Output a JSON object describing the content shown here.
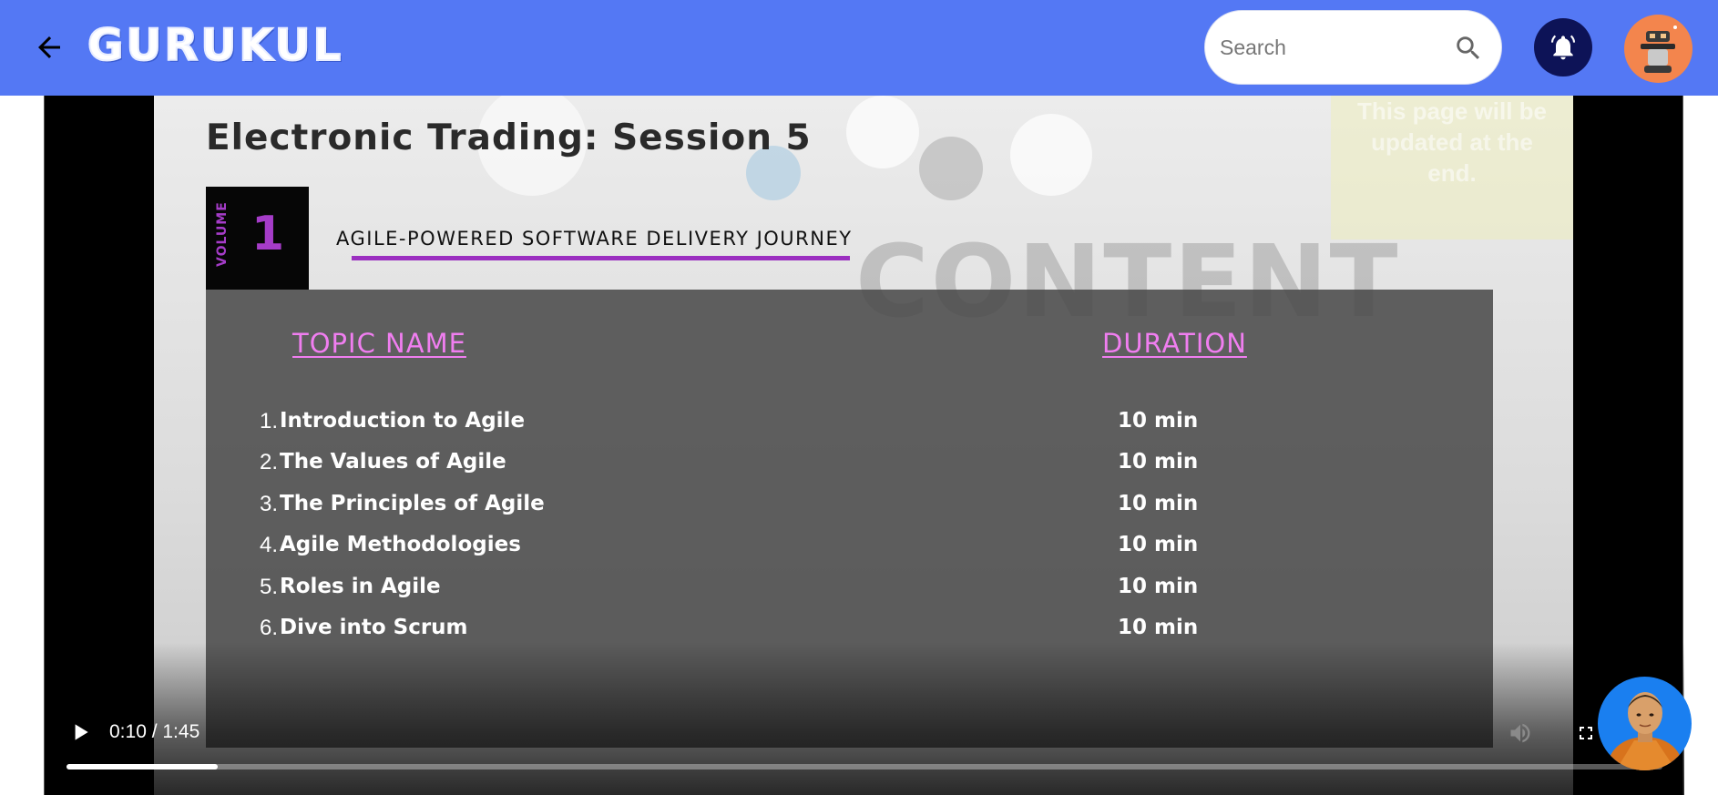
{
  "header": {
    "logo_text": "GURUKUL",
    "search_placeholder": "Search",
    "bg_color": "#5478f4"
  },
  "video": {
    "session_title": "Electronic Trading: Session 5",
    "volume_label": "VOLUME",
    "volume_number": "1",
    "journey_title": "AGILE-POWERED SOFTWARE DELIVERY JOURNEY",
    "background_word": "CONTENT",
    "background_note": "This page will be updated at the end.",
    "columns": {
      "topic": "TOPIC NAME",
      "duration": "DURATION"
    },
    "topics": [
      {
        "num": "1.",
        "name": "Introduction to Agile",
        "duration": "10 min"
      },
      {
        "num": "2.",
        "name": "The Values of Agile",
        "duration": "10 min"
      },
      {
        "num": "3.",
        "name": "The Principles of Agile",
        "duration": "10 min"
      },
      {
        "num": "4.",
        "name": "Agile Methodologies",
        "duration": "10 min"
      },
      {
        "num": "5.",
        "name": "Roles in Agile",
        "duration": "10 min"
      },
      {
        "num": "6.",
        "name": "Dive into Scrum",
        "duration": "10 min"
      }
    ],
    "player": {
      "time_display": "0:10 / 1:45",
      "progress_fraction": 0.095
    }
  },
  "icons": {
    "back": "arrow-left-icon",
    "search": "search-icon",
    "notifications": "bell-icon",
    "play": "play-icon",
    "volume": "volume-icon",
    "fullscreen": "fullscreen-icon"
  },
  "colors": {
    "accent_purple": "#a53cc8",
    "heading_pink": "#f07ef0",
    "bell_bg": "#0d1357",
    "avatar_bg": "#f3854d",
    "assistant_bg": "#1a7ff0"
  }
}
